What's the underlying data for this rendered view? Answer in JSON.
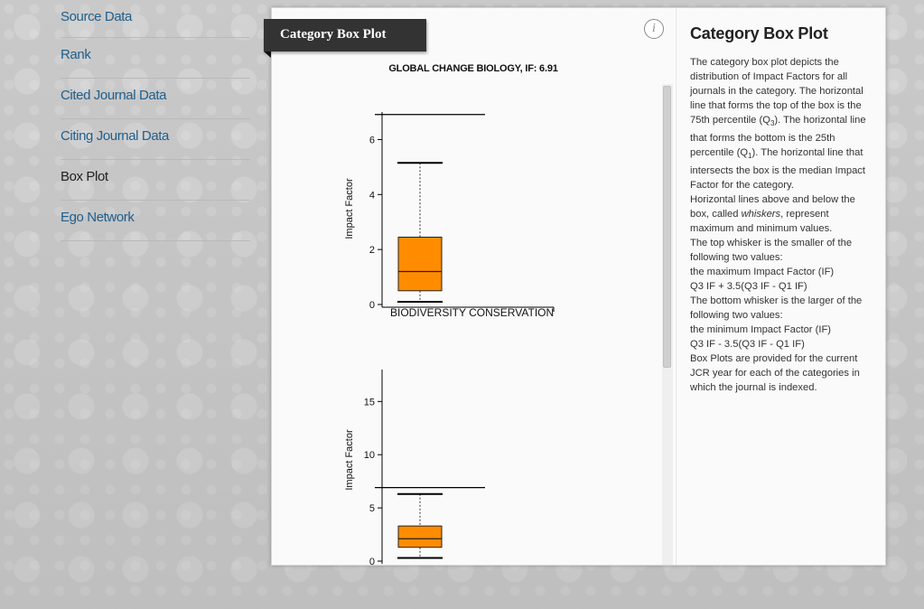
{
  "nav": {
    "items": [
      {
        "label": "Source Data"
      },
      {
        "label": "Rank"
      },
      {
        "label": "Cited Journal Data"
      },
      {
        "label": "Citing Journal Data"
      },
      {
        "label": "Box Plot",
        "active": true
      },
      {
        "label": "Ego Network"
      }
    ]
  },
  "panel": {
    "ribbon_title": "Category Box Plot",
    "info_icon": "i",
    "plot_title": "GLOBAL CHANGE BIOLOGY, IF: 6.91"
  },
  "description": {
    "title": "Category Box Plot",
    "p1a": "The category box plot depicts the distribution of Impact Factors for all journals in the category. The horizontal line that forms the top of the box is the 75th percentile (Q",
    "p1b": "). The horizontal line that forms the bottom is the 25th percentile (Q",
    "p1c": "). The horizontal line that intersects the box is the median Impact Factor for the category.",
    "p2a": "Horizontal lines above and below the box, called ",
    "p2_em": "whiskers",
    "p2b": ", represent maximum and minimum values.",
    "p3": "The top whisker is the smaller of the following two values:",
    "p4": "the maximum Impact Factor (IF)",
    "p5": "Q3 IF + 3.5(Q3 IF - Q1 IF)",
    "p6": "The bottom whisker is the larger of the following two values:",
    "p7": "the minimum Impact Factor (IF)",
    "p8": "Q3 IF - 3.5(Q3 IF - Q1 IF)",
    "p9": "Box Plots are provided for the current JCR year for each of the categories in which the journal is indexed.",
    "sub3": "3",
    "sub1": "1"
  },
  "chart_data": [
    {
      "type": "box",
      "category": "BIODIVERSITY CONSERVATION",
      "ylabel": "Impact Factor",
      "ylim": [
        0,
        7
      ],
      "yticks": [
        0,
        2,
        4,
        6
      ],
      "journal_if": 6.91,
      "box": {
        "whisker_low": 0.1,
        "q1": 0.5,
        "median": 1.2,
        "q3": 2.45,
        "whisker_high": 5.15
      },
      "box_color": "#ff8c00"
    },
    {
      "type": "box",
      "category": "",
      "ylabel": "Impact Factor",
      "ylim": [
        0,
        18
      ],
      "yticks": [
        0,
        5,
        10,
        15
      ],
      "journal_if": 6.91,
      "box": {
        "whisker_low": 0.3,
        "q1": 1.3,
        "median": 2.1,
        "q3": 3.3,
        "whisker_high": 6.3
      },
      "box_color": "#ff8c00"
    }
  ]
}
